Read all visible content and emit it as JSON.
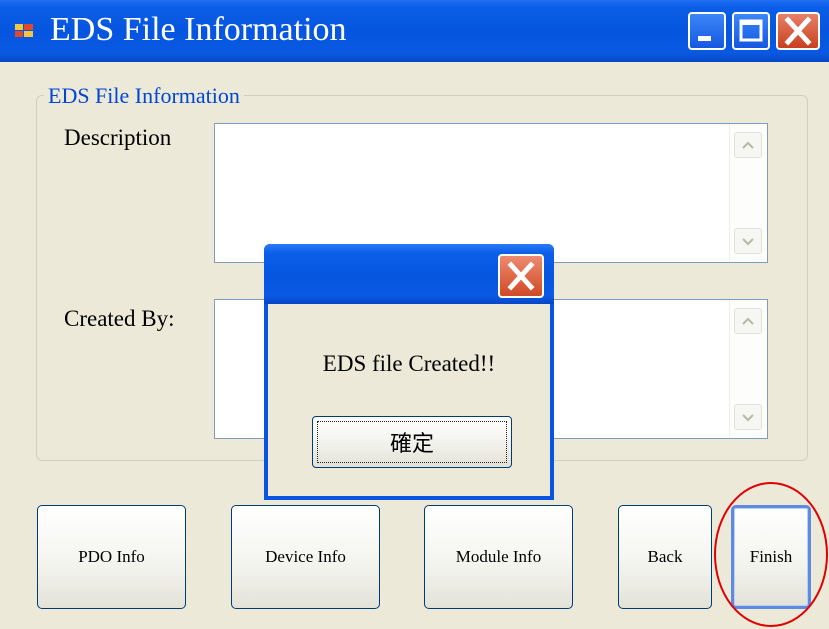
{
  "window": {
    "title": "EDS File Information",
    "icons": {
      "app": "app-window-icon",
      "minimize": "minimize-icon",
      "maximize": "maximize-icon",
      "close": "close-icon"
    }
  },
  "group": {
    "legend": "EDS File Information",
    "description_label": "Description",
    "description_value": "",
    "created_by_label": "Created By:",
    "created_by_value": ""
  },
  "buttons": {
    "pdo_info": "PDO Info",
    "device_info": "Device Info",
    "module_info": "Module Info",
    "back": "Back",
    "finish": "Finish"
  },
  "dialog": {
    "title": "",
    "message": "EDS file Created!!",
    "ok_label": "確定"
  },
  "colors": {
    "titlebar": "#0655e0",
    "window_bg": "#ece9d8",
    "legend_text": "#0046d5",
    "highlight_circle": "#e00000"
  }
}
